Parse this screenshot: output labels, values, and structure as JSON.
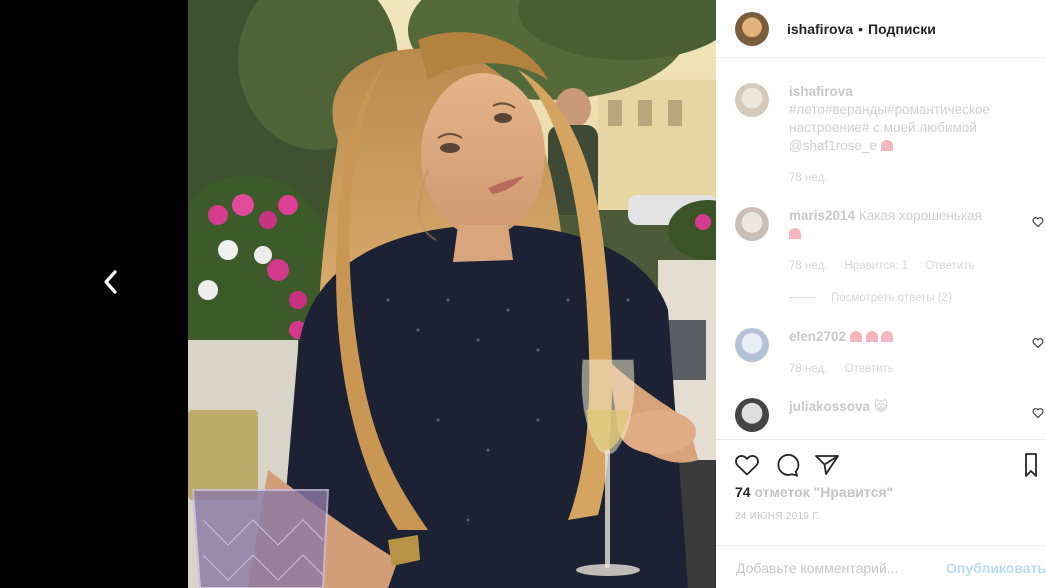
{
  "photo_alt": "",
  "header": {
    "username": "ishafirova",
    "separator": "•",
    "follow_label": "Подписки"
  },
  "caption": {
    "username": "ishafirova",
    "text": "#лето#веранды#романтическое настроение# с моей любимой @shaf1rose_e",
    "time": "78 нед."
  },
  "comments": [
    {
      "username": "maris2014",
      "text": "Какая хорошенькая",
      "time": "78 нед.",
      "likes": "Нравится: 1",
      "reply": "Ответить",
      "view_replies": "Посмотреть ответы (2)"
    },
    {
      "username": "elen2702",
      "text": "",
      "time": "78 нед.",
      "reply": "Ответить"
    },
    {
      "username": "juliakossova",
      "text": "😸"
    }
  ],
  "actions": {
    "like_icon": "heart-outline-icon",
    "comment_icon": "comment-bubble-icon",
    "share_icon": "paper-plane-icon",
    "save_icon": "bookmark-icon"
  },
  "likes": {
    "count": "74",
    "label": "отметок \"Нравится\""
  },
  "date": "24 ИЮНЯ 2019 Г.",
  "add_comment": {
    "placeholder": "Добавьте комментарий...",
    "publish_label": "Опубликовать"
  },
  "colors": {
    "accent_blue": "#0095f6",
    "heart_pink": "#f5b6c0"
  }
}
